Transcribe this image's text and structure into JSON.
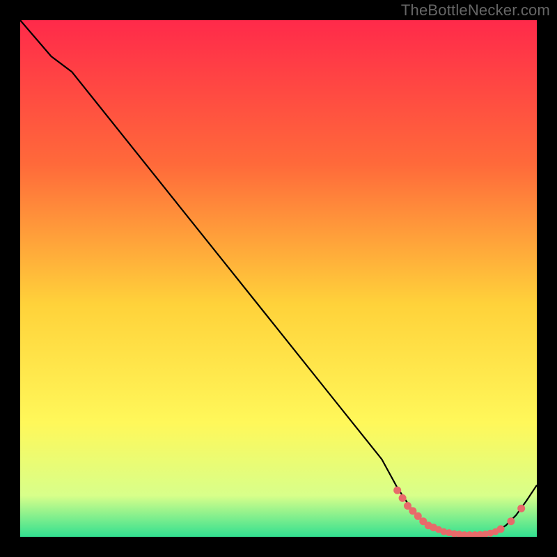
{
  "watermark": "TheBottleNecker.com",
  "colors": {
    "bg_top": "#ff2a4a",
    "bg_mid_top": "#ff6a3a",
    "bg_mid": "#ffd23a",
    "bg_mid_low": "#fff85a",
    "bg_low": "#d8ff8a",
    "bg_bottom": "#32e090",
    "line": "#000000",
    "marker": "#e86a6a"
  },
  "chart_data": {
    "type": "line",
    "title": "",
    "xlabel": "",
    "ylabel": "",
    "xlim": [
      0,
      100
    ],
    "ylim": [
      0,
      100
    ],
    "series": [
      {
        "name": "curve",
        "x": [
          0,
          6,
          10,
          20,
          30,
          40,
          50,
          60,
          70,
          73,
          76,
          78,
          80,
          82,
          84,
          86,
          88,
          90,
          92,
          94,
          96,
          98,
          100
        ],
        "y": [
          100,
          93,
          90,
          77.5,
          65,
          52.5,
          40,
          27.5,
          15,
          9.5,
          5,
          3,
          1.8,
          1,
          0.6,
          0.4,
          0.4,
          0.5,
          1,
          2.2,
          4.2,
          7,
          10
        ]
      }
    ],
    "markers": {
      "x": [
        73,
        74,
        75,
        76,
        77,
        78,
        79,
        80,
        81,
        82,
        83,
        84,
        85,
        86,
        87,
        88,
        89,
        90,
        91,
        92,
        93,
        95,
        97
      ],
      "y": [
        9.0,
        7.5,
        6.0,
        5.0,
        4.0,
        3.0,
        2.2,
        1.8,
        1.4,
        1.0,
        0.8,
        0.6,
        0.5,
        0.4,
        0.4,
        0.4,
        0.45,
        0.5,
        0.7,
        1.0,
        1.5,
        3.0,
        5.5
      ],
      "r": [
        5.5,
        5.5,
        5.5,
        5.5,
        5.5,
        5.5,
        5.5,
        5.5,
        5,
        5,
        5,
        5,
        5,
        5,
        5,
        5,
        5,
        5,
        5,
        5,
        5.5,
        5.5,
        5.5
      ]
    }
  }
}
